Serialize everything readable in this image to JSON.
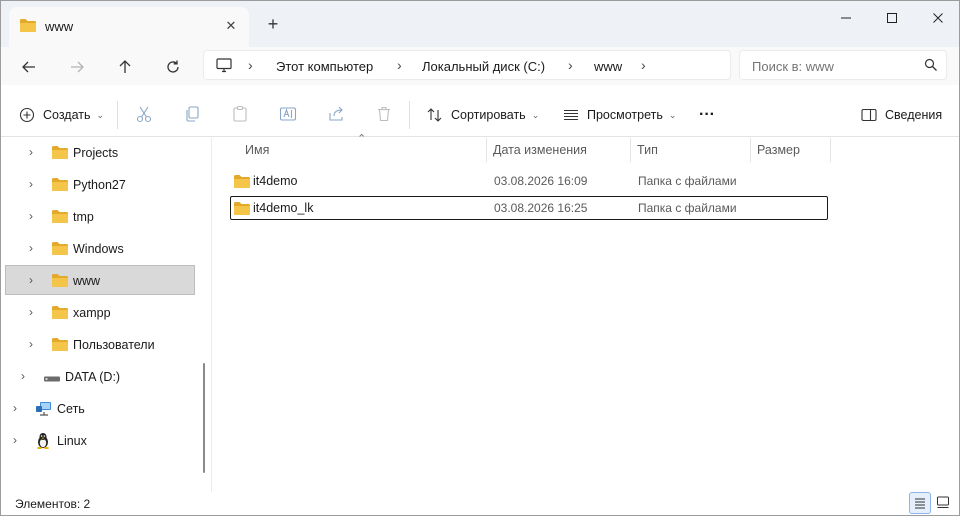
{
  "tab": {
    "title": "www",
    "close": "✕",
    "new_tab": "+"
  },
  "window_controls": {
    "minimize": "—",
    "maximize": "☐",
    "close": "✕"
  },
  "nav": {
    "back": "←",
    "forward": "→",
    "up": "↑",
    "refresh": "↻"
  },
  "breadcrumb": [
    {
      "label": "Этот компьютер"
    },
    {
      "label": "Локальный диск (C:)"
    },
    {
      "label": "www"
    }
  ],
  "search": {
    "placeholder": "Поиск в: www"
  },
  "toolbar": {
    "new_label": "Создать",
    "sort_label": "Сортировать",
    "view_label": "Просмотреть",
    "more_label": "···",
    "details_label": "Сведения"
  },
  "sidebar": {
    "items": [
      {
        "label": "Projects",
        "icon": "folder-icon"
      },
      {
        "label": "Python27",
        "icon": "folder-icon"
      },
      {
        "label": "tmp",
        "icon": "folder-icon"
      },
      {
        "label": "Windows",
        "icon": "folder-icon"
      },
      {
        "label": "www",
        "icon": "folder-icon",
        "selected": true
      },
      {
        "label": "xampp",
        "icon": "folder-icon"
      },
      {
        "label": "Пользователи",
        "icon": "folder-icon"
      },
      {
        "label": "DATA (D:)",
        "icon": "drive-icon"
      },
      {
        "label": "Сеть",
        "icon": "network-icon"
      },
      {
        "label": "Linux",
        "icon": "linux-icon"
      }
    ]
  },
  "columns": {
    "name": "Имя",
    "modified": "Дата изменения",
    "type": "Тип",
    "size": "Размер"
  },
  "files": [
    {
      "name": "it4demo",
      "modified": "03.08.2026 16:09",
      "type": "Папка с файлами"
    },
    {
      "name": "it4demo_lk",
      "modified": "03.08.2026 16:25",
      "type": "Папка с файлами"
    }
  ],
  "status": {
    "count": "Элементов: 2"
  },
  "colors": {
    "folder": "#f5c54a",
    "folder_dark": "#e3a92b",
    "accent": "#0067c0",
    "selected": "#d9d9d9"
  }
}
